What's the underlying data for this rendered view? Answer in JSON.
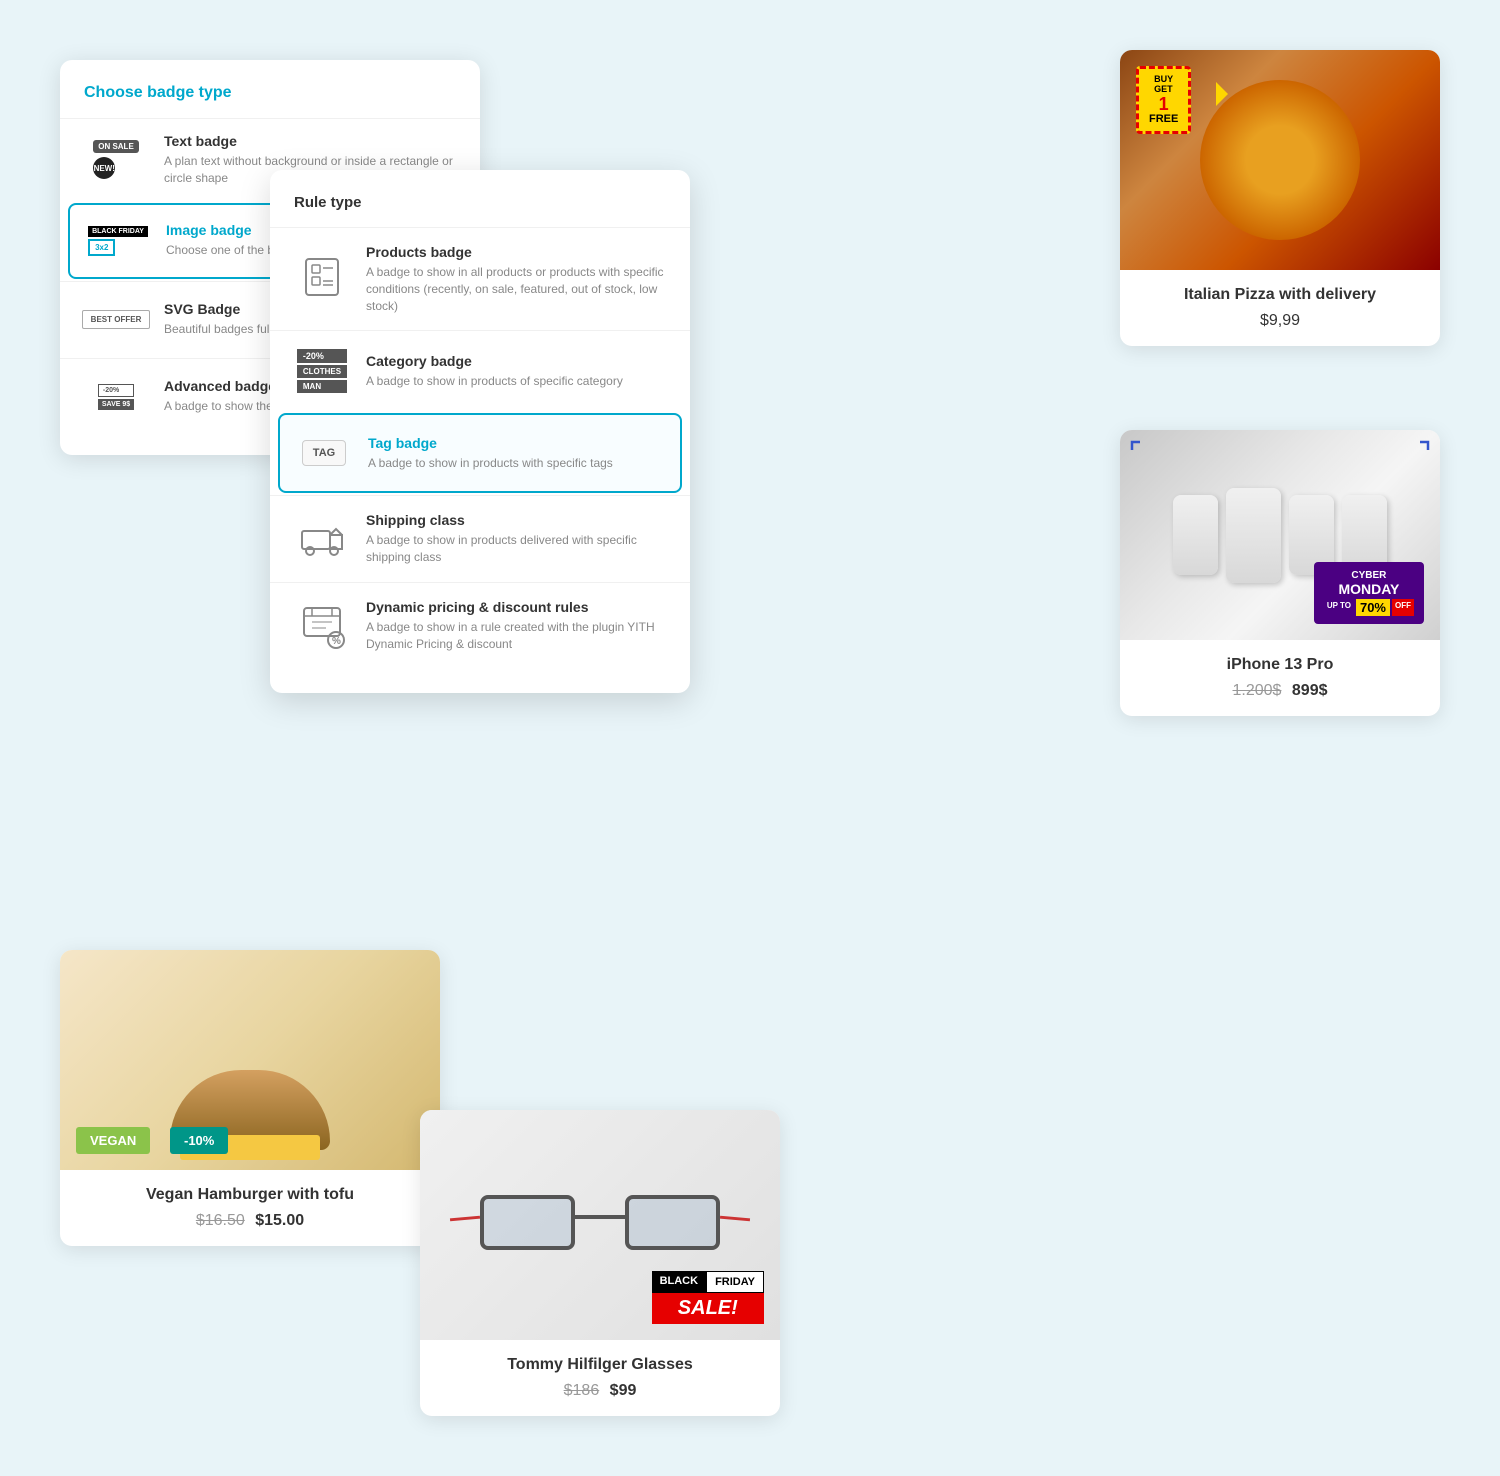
{
  "badgeTypePanel": {
    "title": "Choose badge type",
    "items": [
      {
        "id": "text",
        "name": "Text badge",
        "description": "A plan text without background or inside a rectangle or circle shape",
        "active": false
      },
      {
        "id": "image",
        "name": "Image badge",
        "description": "Choose one of the b",
        "active": true
      },
      {
        "id": "svg",
        "name": "SVG Badge",
        "description": "Beautiful badges fully",
        "active": false
      },
      {
        "id": "advanced",
        "name": "Advanced badge f",
        "description": "A badge to show the regular price and sa",
        "active": false
      }
    ]
  },
  "ruleTypePanel": {
    "title": "Rule type",
    "items": [
      {
        "id": "products",
        "name": "Products badge",
        "description": "A badge to show in all products or products with specific conditions (recently, on sale, featured, out of stock, low stock)",
        "active": false
      },
      {
        "id": "category",
        "name": "Category badge",
        "description": "A badge to show in products of specific category",
        "active": false
      },
      {
        "id": "tag",
        "name": "Tag badge",
        "description": "A badge to show in products with specific tags",
        "active": true
      },
      {
        "id": "shipping",
        "name": "Shipping class",
        "description": "A badge to show in products delivered with specific shipping class",
        "active": false
      },
      {
        "id": "dynamic",
        "name": "Dynamic pricing & discount rules",
        "description": "A badge to show in a rule created with the plugin YITH Dynamic Pricing & discount",
        "active": false
      }
    ]
  },
  "products": [
    {
      "id": "pizza",
      "name": "Italian Pizza with delivery",
      "price": "$9,99",
      "badge": "BUY GET 1 FREE"
    },
    {
      "id": "iphone",
      "name": "iPhone 13 Pro",
      "priceOriginal": "1.200$",
      "priceSale": "899$",
      "badge": "CYBER MONDAY 70% OFF"
    },
    {
      "id": "hamburger",
      "name": "Vegan Hamburger with tofu",
      "priceOriginal": "$16.50",
      "priceSale": "$15.00",
      "badges": [
        "VEGAN",
        "-10%"
      ]
    },
    {
      "id": "glasses",
      "name": "Tommy Hilfilger Glasses",
      "priceOriginal": "$186",
      "priceSale": "$99",
      "badge": "BLACK FRIDAY SALE!"
    }
  ],
  "colors": {
    "accent": "#00a8cc",
    "vegan": "#8bc34a",
    "teal": "#009688",
    "gold": "#ffd700",
    "red": "#e60000",
    "purple": "#4b0082"
  }
}
